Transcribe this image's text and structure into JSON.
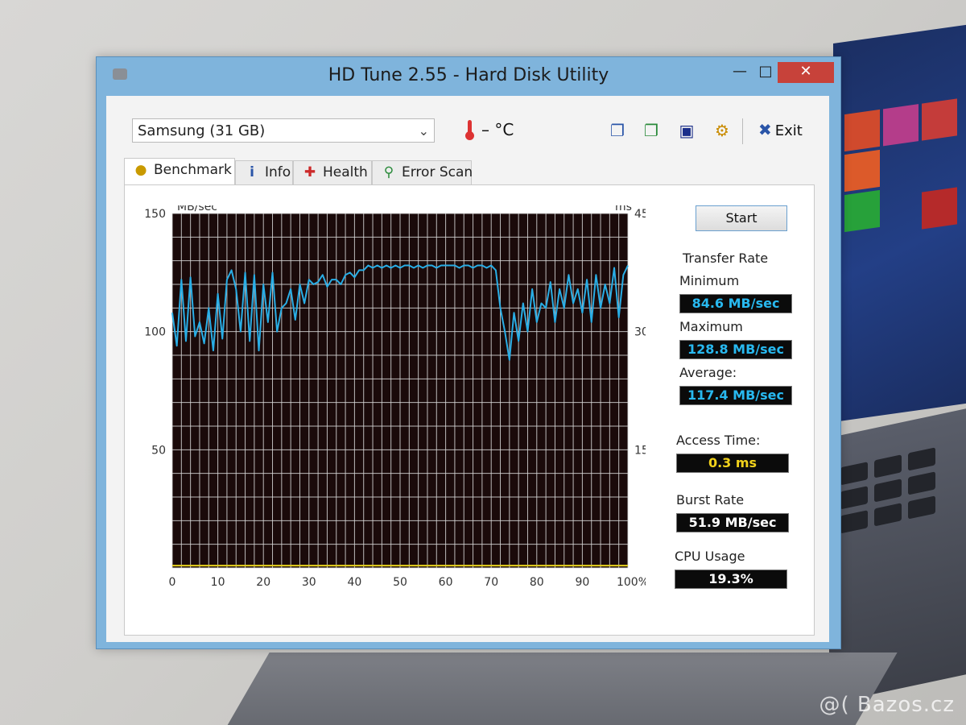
{
  "window": {
    "title": "HD Tune 2.55 - Hard Disk Utility"
  },
  "toolbar": {
    "drive": "Samsung (31 GB)",
    "temperature": "– °C",
    "exit_label": "Exit"
  },
  "tabs": [
    {
      "label": "Benchmark",
      "icon": "lightbulb-icon"
    },
    {
      "label": "Info",
      "icon": "info-icon"
    },
    {
      "label": "Health",
      "icon": "health-cross-icon"
    },
    {
      "label": "Error Scan",
      "icon": "magnifier-icon"
    }
  ],
  "panel": {
    "start_label": "Start",
    "transfer_rate_label": "Transfer Rate",
    "minimum_label": "Minimum",
    "minimum_value": "84.6 MB/sec",
    "maximum_label": "Maximum",
    "maximum_value": "128.8 MB/sec",
    "average_label": "Average:",
    "average_value": "117.4 MB/sec",
    "access_time_label": "Access Time:",
    "access_time_value": "0.3 ms",
    "burst_rate_label": "Burst Rate",
    "burst_rate_value": "51.9 MB/sec",
    "cpu_usage_label": "CPU Usage",
    "cpu_usage_value": "19.3%"
  },
  "watermark": "@( Bazos.cz",
  "colors": {
    "transfer_line": "#29aee6",
    "access_line": "#e6d21e",
    "grid": "#d9d9d9",
    "plot_bg": "#1a0a0a"
  },
  "chart_data": {
    "type": "line",
    "y_left_label": "MB/sec",
    "y_right_label": "ms",
    "y_left_ticks": [
      "150",
      "100",
      "50"
    ],
    "y_right_ticks": [
      "45",
      "30",
      "15"
    ],
    "x_ticks": [
      "0",
      "10",
      "20",
      "30",
      "40",
      "50",
      "60",
      "70",
      "80",
      "90",
      "100%"
    ],
    "xlim": [
      0,
      100
    ],
    "ylim_left": [
      0,
      150
    ],
    "ylim_right": [
      0,
      45
    ],
    "grid": true,
    "series": [
      {
        "axis": "left",
        "x": [
          0,
          1,
          2,
          3,
          4,
          5,
          6,
          7,
          8,
          9,
          10,
          11,
          12,
          13,
          14,
          15,
          16,
          17,
          18,
          19,
          20,
          21,
          22,
          23,
          24,
          25,
          26,
          27,
          28,
          29,
          30,
          31,
          32,
          33,
          34,
          35,
          36,
          37,
          38,
          39,
          40,
          41,
          42,
          43,
          44,
          45,
          46,
          47,
          48,
          49,
          50,
          51,
          52,
          53,
          54,
          55,
          56,
          57,
          58,
          59,
          60,
          61,
          62,
          63,
          64,
          65,
          66,
          67,
          68,
          69,
          70,
          71,
          72,
          73,
          74,
          75,
          76,
          77,
          78,
          79,
          80,
          81,
          82,
          83,
          84,
          85,
          86,
          87,
          88,
          89,
          90,
          91,
          92,
          93,
          94,
          95,
          96,
          97,
          98,
          99,
          100
        ],
        "y": [
          108,
          94,
          122,
          96,
          123,
          98,
          104,
          95,
          110,
          92,
          116,
          97,
          122,
          126,
          118,
          100,
          125,
          96,
          124,
          92,
          120,
          104,
          125,
          100,
          110,
          112,
          118,
          105,
          120,
          112,
          122,
          120,
          121,
          124,
          119,
          122,
          122,
          120,
          124,
          125,
          123,
          126,
          126,
          128,
          127,
          128,
          127,
          128,
          127,
          128,
          127,
          128,
          128,
          127,
          128,
          127,
          128,
          128,
          127,
          128,
          128,
          128,
          128,
          127,
          128,
          128,
          127,
          128,
          128,
          127,
          128,
          126,
          110,
          100,
          88,
          108,
          96,
          112,
          100,
          118,
          104,
          112,
          110,
          121,
          104,
          118,
          110,
          124,
          112,
          118,
          108,
          122,
          104,
          124,
          110,
          120,
          112,
          127,
          106,
          124,
          128
        ]
      }
    ],
    "access_time_baseline": 0.3
  }
}
